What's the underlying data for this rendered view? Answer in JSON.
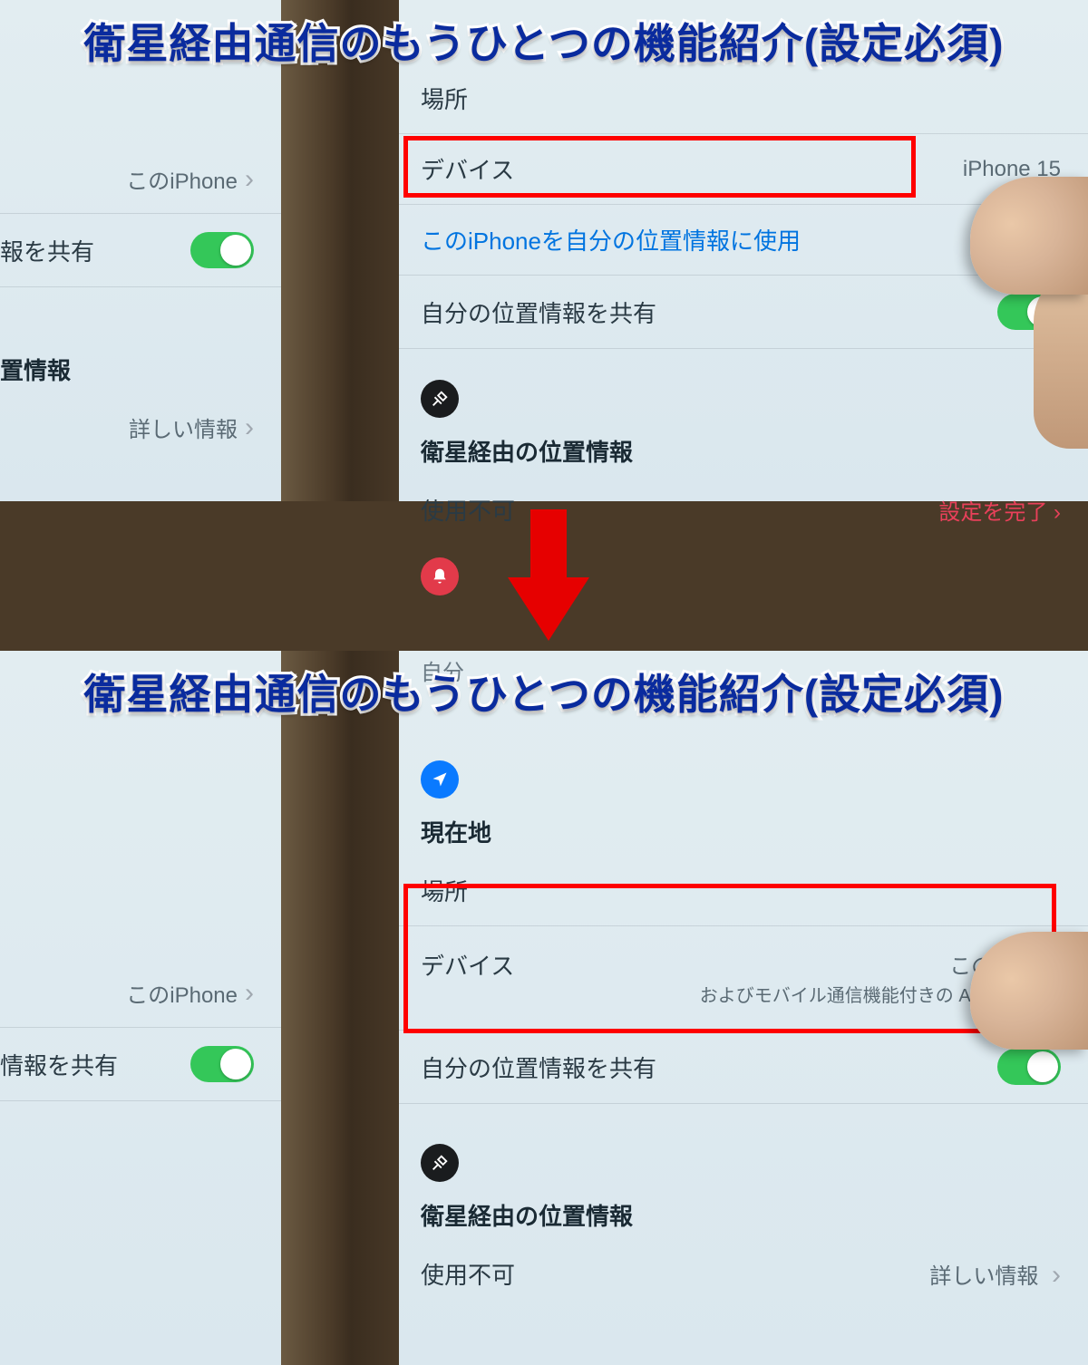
{
  "caption": "衛星経由通信のもうひとつの機能紹介(設定必須)",
  "top": {
    "left": {
      "this_iphone": "このiPhone",
      "share_label": "報を共有",
      "location_header": "置情報",
      "more_info": "詳しい情報"
    },
    "right": {
      "location_label": "場所",
      "device_label": "デバイス",
      "device_value": "iPhone 15",
      "use_this_iphone": "このiPhoneを自分の位置情報に使用",
      "share_label": "自分の位置情報を共有",
      "sat_header": "衛星経由の位置情報",
      "unavailable": "使用不可",
      "complete_setup": "設定を完了"
    }
  },
  "bottom": {
    "left": {
      "this_iphone": "このiPhone",
      "share_label": "情報を共有"
    },
    "right": {
      "self": "自分",
      "current": "現在地",
      "location_label": "場所",
      "device_label": "デバイス",
      "device_value1": "このiPhone",
      "device_value2": "およびモバイル通信機能付きの Apple Watch",
      "share_label": "自分の位置情報を共有",
      "sat_header": "衛星経由の位置情報",
      "unavailable": "使用不可",
      "more_info": "詳しい情報"
    }
  }
}
